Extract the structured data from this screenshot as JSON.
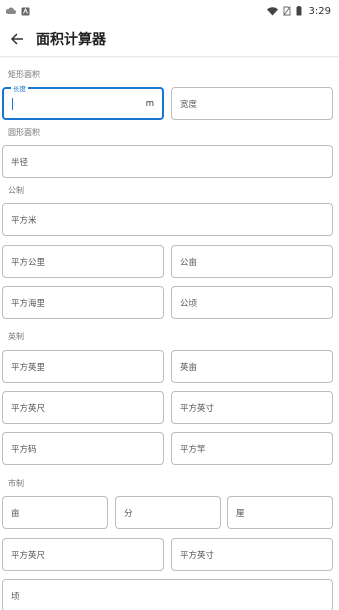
{
  "status_bar": {
    "time": "3:29"
  },
  "app_bar": {
    "title": "面积计算器"
  },
  "sections": {
    "rect": "矩形面积",
    "circle": "圆形面积",
    "metric": "公制",
    "imperial": "英制",
    "market": "市制"
  },
  "fields": {
    "length_label": "长度",
    "length_unit": "m",
    "width": "宽度",
    "radius": "半径",
    "sq_m": "平方米",
    "sq_km": "平方公里",
    "gongmu": "公亩",
    "sq_nmi": "平方海里",
    "hectare": "公顷",
    "sq_mile": "平方英里",
    "acre": "英亩",
    "sq_ft": "平方英尺",
    "sq_in": "平方英寸",
    "sq_yd": "平方码",
    "sq_rod": "平方竿",
    "mu": "亩",
    "fen": "分",
    "li": "厘",
    "sq_chi": "平方英尺",
    "sq_cun": "平方英寸",
    "qing": "顷"
  }
}
